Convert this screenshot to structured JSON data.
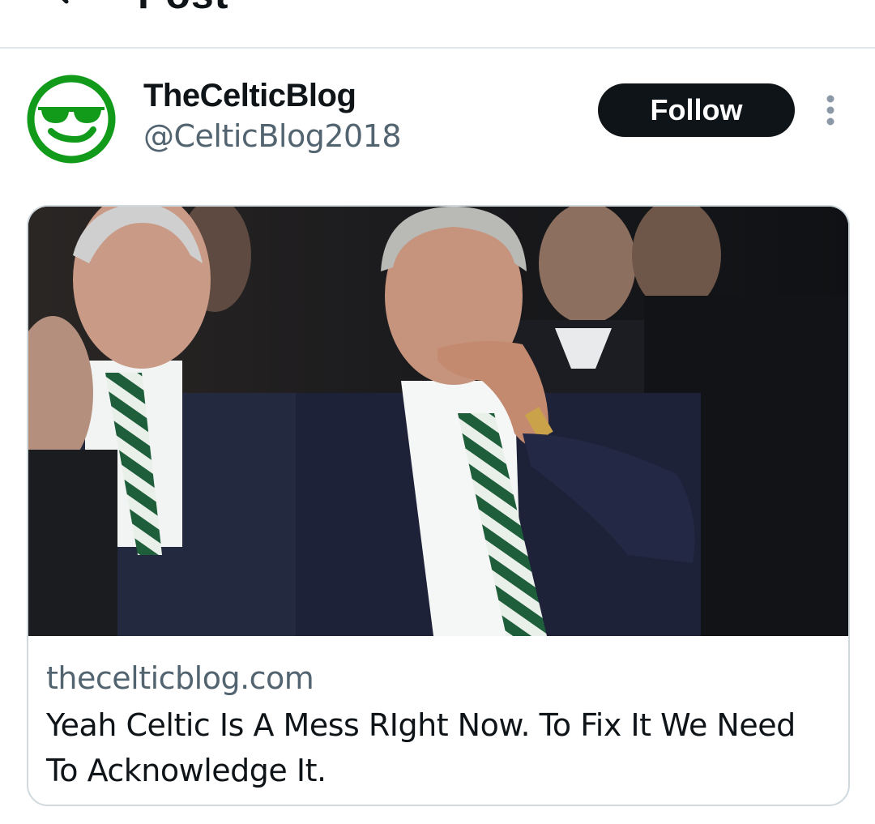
{
  "header": {
    "title": "Post",
    "back_icon": "back-arrow-icon"
  },
  "author": {
    "name": "TheCelticBlog",
    "handle": "@CelticBlog2018",
    "avatar_icon": "sunglasses-face-icon",
    "avatar_color": "#129b1a"
  },
  "actions": {
    "follow_label": "Follow",
    "more_icon": "more-vertical-icon"
  },
  "card": {
    "domain": "thecelticblog.com",
    "title": "Yeah Celtic Is A Mess RIght Now. To Fix It We Need To Acknowledge It."
  },
  "colors": {
    "text_primary": "#0f1419",
    "text_secondary": "#536471",
    "follow_bg": "#0f1419",
    "border": "#cfd9de"
  }
}
